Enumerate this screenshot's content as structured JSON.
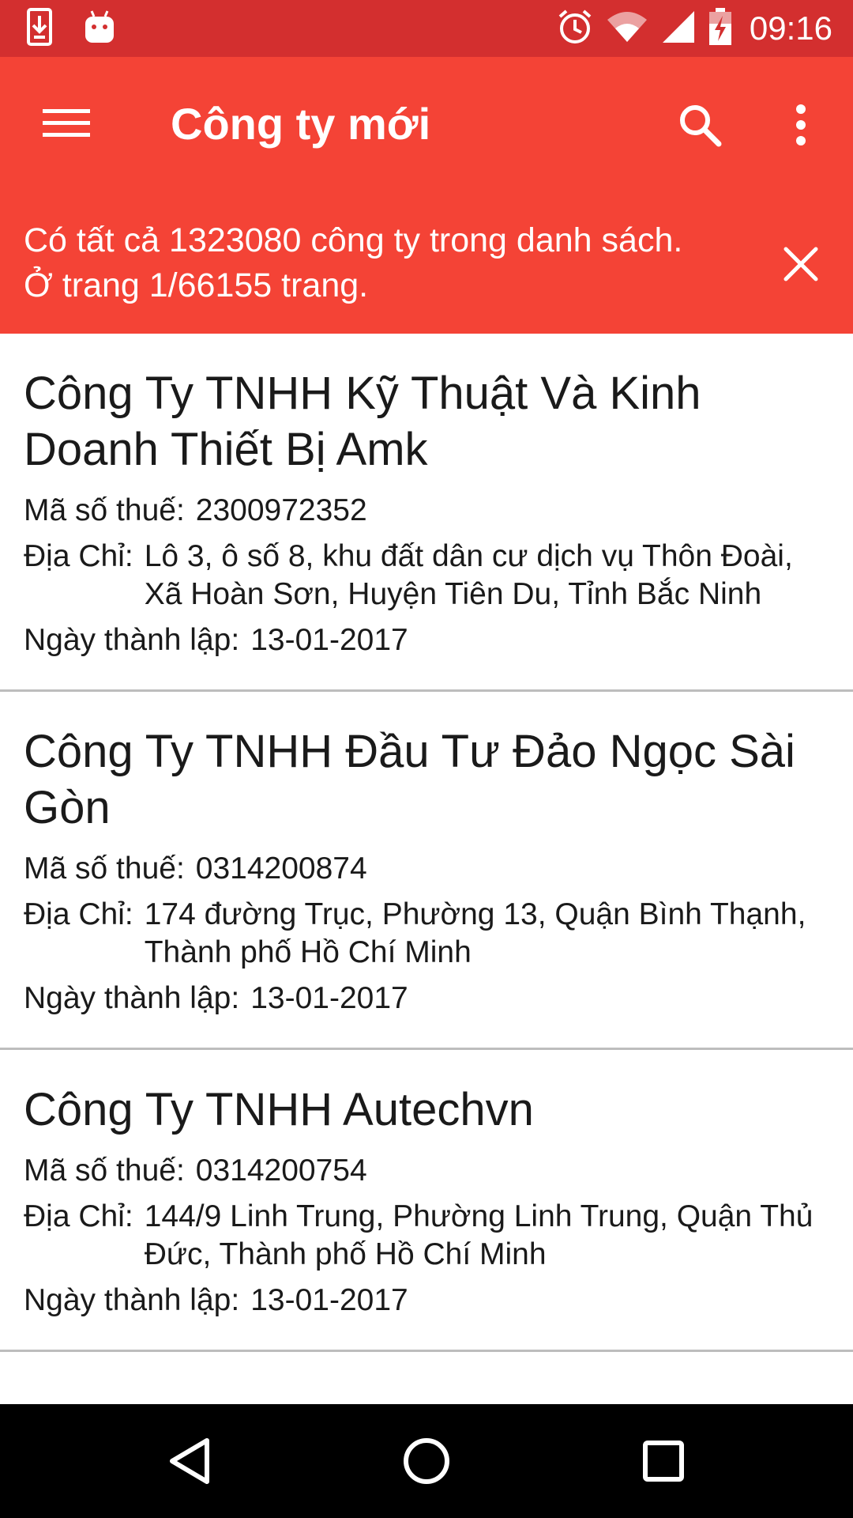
{
  "status_bar": {
    "time": "09:16",
    "left_icons": [
      "download-icon",
      "android-icon"
    ],
    "right_icons": [
      "alarm-icon",
      "wifi-icon",
      "signal-icon",
      "battery-icon"
    ]
  },
  "app_bar": {
    "title": "Công ty mới",
    "color": "#f44336"
  },
  "banner": {
    "text": "Có tất cả 1323080 công ty trong danh sách. Ở trang 1/66155 trang."
  },
  "companies": [
    {
      "name": "Công Ty TNHH Kỹ Thuật Và Kinh Doanh Thiết Bị Amk",
      "tax_label": "Mã số thuế:",
      "tax_code": "2300972352",
      "address_label": "Địa Chỉ:",
      "address": "Lô 3, ô số 8, khu đất dân cư dịch vụ Thôn Đoài, Xã Hoàn Sơn, Huyện Tiên Du, Tỉnh Bắc Ninh",
      "date_label": "Ngày thành lập:",
      "date": "13-01-2017"
    },
    {
      "name": "Công Ty TNHH Đầu Tư Đảo Ngọc Sài Gòn",
      "tax_label": "Mã số thuế:",
      "tax_code": "0314200874",
      "address_label": "Địa Chỉ:",
      "address": "174 đường Trục, Phường 13, Quận Bình Thạnh, Thành phố Hồ Chí Minh",
      "date_label": "Ngày thành lập:",
      "date": "13-01-2017"
    },
    {
      "name": "Công Ty TNHH Autechvn",
      "tax_label": "Mã số thuế:",
      "tax_code": "0314200754",
      "address_label": "Địa Chỉ:",
      "address": "144/9 Linh Trung, Phường Linh Trung, Quận Thủ Đức, Thành phố Hồ Chí Minh",
      "date_label": "Ngày thành lập:",
      "date": "13-01-2017"
    }
  ],
  "nav_bar": {
    "buttons": [
      "back-icon",
      "home-icon",
      "recents-icon"
    ]
  }
}
